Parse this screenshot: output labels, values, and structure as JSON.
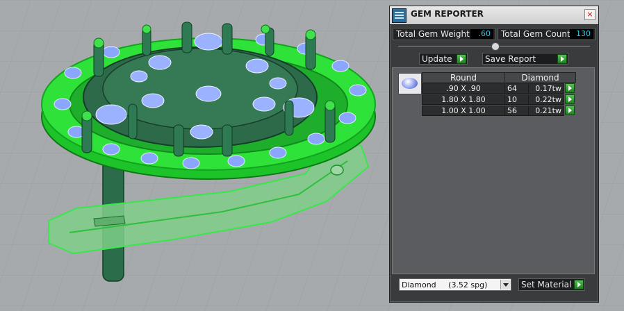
{
  "panel": {
    "title": "GEM REPORTER",
    "close_glyph": "×",
    "total_weight_label": "Total Gem Weight",
    "total_weight_value": ".60",
    "total_count_label": "Total Gem Count",
    "total_count_value": "130",
    "update_label": "Update",
    "save_report_label": "Save Report",
    "table": {
      "headers": [
        "Round",
        "Diamond"
      ],
      "rows": [
        {
          "size": ".90 X .90",
          "count": "64",
          "weight": "0.17tw"
        },
        {
          "size": "1.80 X 1.80",
          "count": "10",
          "weight": "0.22tw"
        },
        {
          "size": "1.00 X 1.00",
          "count": "56",
          "weight": "0.21tw"
        }
      ]
    },
    "material_select_value": "Diamond     (3.52 spg)",
    "set_material_label": "Set Material"
  },
  "icons": {
    "app": "gem-reporter-app-icon",
    "close": "close-icon",
    "go": "play-arrow-icon",
    "gem": "round-gem-icon",
    "dropdown": "chevron-down-icon"
  },
  "colors": {
    "viewport_bg": "#a7aaac",
    "ring_green": "#1fdd2a",
    "prong_dark": "#2a6a48",
    "gem_blue": "#8aa6ff",
    "value_cyan": "#34c9e8"
  }
}
